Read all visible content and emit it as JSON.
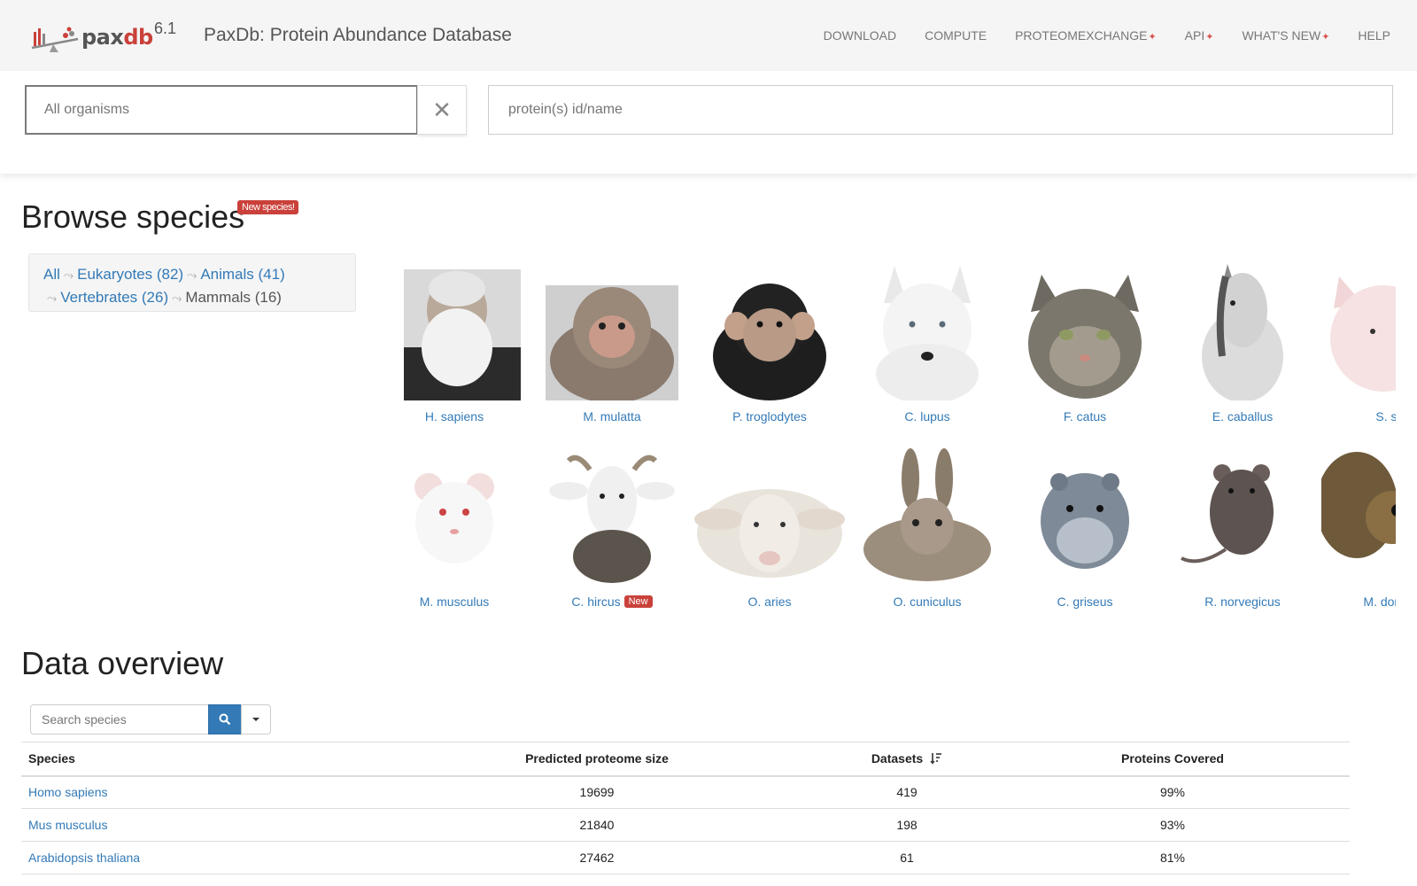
{
  "header": {
    "logo_word_a": "pax",
    "logo_word_b": "db",
    "logo_version": "6.1",
    "site_title": "PaxDb: Protein Abundance Database",
    "nav": [
      {
        "label": "DOWNLOAD",
        "new": false
      },
      {
        "label": "COMPUTE",
        "new": false
      },
      {
        "label": "PROTEOMEXCHANGE",
        "new": true
      },
      {
        "label": "API",
        "new": true
      },
      {
        "label": "WHAT'S NEW",
        "new": true
      },
      {
        "label": "HELP",
        "new": false
      }
    ]
  },
  "search": {
    "organism_placeholder": "All organisms",
    "clear_glyph": "✕",
    "protein_placeholder": "protein(s) id/name"
  },
  "browse": {
    "title": "Browse species",
    "new_badge": "New species!",
    "breadcrumb": {
      "all": "All",
      "eukaryotes": "Eukaryotes (82)",
      "animals": "Animals (41)",
      "vertebrates": "Vertebrates (26)",
      "mammals": "Mammals (16)",
      "separator": "⤳"
    },
    "species": [
      {
        "name": "H. sapiens",
        "new": false
      },
      {
        "name": "M. mulatta",
        "new": false
      },
      {
        "name": "P. troglodytes",
        "new": false
      },
      {
        "name": "C. lupus",
        "new": false
      },
      {
        "name": "F. catus",
        "new": false
      },
      {
        "name": "E. caballus",
        "new": false
      },
      {
        "name": "S. scrofa",
        "new": false
      },
      {
        "name": "M. musculus",
        "new": false
      },
      {
        "name": "C. hircus",
        "new": true
      },
      {
        "name": "O. aries",
        "new": false
      },
      {
        "name": "O. cuniculus",
        "new": false
      },
      {
        "name": "C. griseus",
        "new": false
      },
      {
        "name": "R. norvegicus",
        "new": false
      },
      {
        "name": "M. domestica",
        "new": false
      }
    ],
    "new_tag": "New"
  },
  "overview": {
    "title": "Data overview",
    "search_placeholder": "Search species",
    "columns": [
      "Species",
      "Predicted proteome size",
      "Datasets",
      "Proteins Covered"
    ],
    "rows": [
      {
        "species": "Homo sapiens",
        "proteome": "19699",
        "datasets": "419",
        "coverage": "99%"
      },
      {
        "species": "Mus musculus",
        "proteome": "21840",
        "datasets": "198",
        "coverage": "93%"
      },
      {
        "species": "Arabidopsis thaliana",
        "proteome": "27462",
        "datasets": "61",
        "coverage": "81%"
      }
    ]
  },
  "colors": {
    "accent_link": "#337ab7",
    "brand_red": "#c9413a",
    "header_bg": "#f5f5f5"
  }
}
